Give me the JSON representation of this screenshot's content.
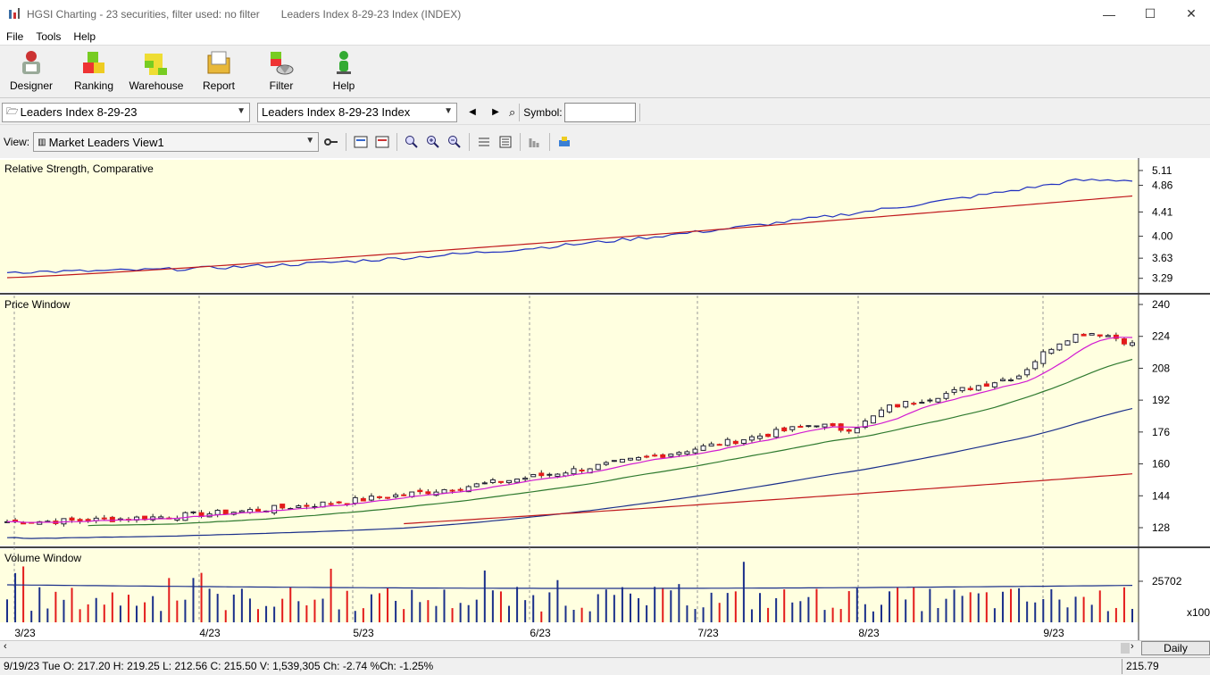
{
  "window": {
    "title": "HGSI Charting - 23 securities, filter used: no filter",
    "doc_title": "Leaders Index 8-29-23 Index (INDEX)",
    "min": "—",
    "max": "☐",
    "close": "✕"
  },
  "menu": [
    "File",
    "Tools",
    "Help"
  ],
  "toolbar": [
    {
      "label": "Designer",
      "icon": "designer-icon"
    },
    {
      "label": "Ranking",
      "icon": "ranking-icon"
    },
    {
      "label": "Warehouse",
      "icon": "warehouse-icon"
    },
    {
      "label": "Report",
      "icon": "report-icon"
    },
    {
      "label": "Filter",
      "icon": "filter-icon"
    },
    {
      "label": "Help",
      "icon": "help-icon"
    }
  ],
  "nav": {
    "list_select": "Leaders Index 8-29-23",
    "security_select": "Leaders Index 8-29-23 Index",
    "symbol_label": "Symbol:",
    "symbol_value": "",
    "prev": "◀",
    "next": "▶"
  },
  "view": {
    "label": "View:",
    "value": "Market Leaders View1"
  },
  "panes": {
    "rs": {
      "title": "Relative Strength, Comparative",
      "ticks": [
        "5.11",
        "4.86",
        "4.41",
        "4.00",
        "3.63",
        "3.29"
      ]
    },
    "price": {
      "title": "Price Window",
      "ticks": [
        "240",
        "224",
        "208",
        "192",
        "176",
        "160",
        "144",
        "128"
      ]
    },
    "volume": {
      "title": "Volume Window",
      "ticks": [
        "25702"
      ],
      "unit": "x100"
    }
  },
  "x_axis": {
    "labels": [
      "3/23",
      "4/23",
      "5/23",
      "6/23",
      "7/23",
      "8/23",
      "9/23"
    ]
  },
  "period": "Daily",
  "status": {
    "text": "9/19/23 Tue O: 217.20 H: 219.25 L: 212.56 C: 215.50 V: 1,539,305 Ch: -2.74 %Ch: -1.25%",
    "price": "215.79"
  },
  "colors": {
    "pane_bg": "#ffffe0",
    "up": "#ffffff",
    "down": "#e31b1b",
    "rs_line": "#1f2fbf",
    "ma_long": "#c0181c",
    "ma_mid": "#1a2f8a",
    "ma_short": "#2f7a2f",
    "ma_fast": "#d21ad2"
  },
  "chart_data": {
    "type": "candlestick",
    "price_start": 131,
    "price_end": 220,
    "rs_start": 3.35,
    "rs_end": 5.05,
    "volume_ticks": [
      "25702"
    ]
  }
}
